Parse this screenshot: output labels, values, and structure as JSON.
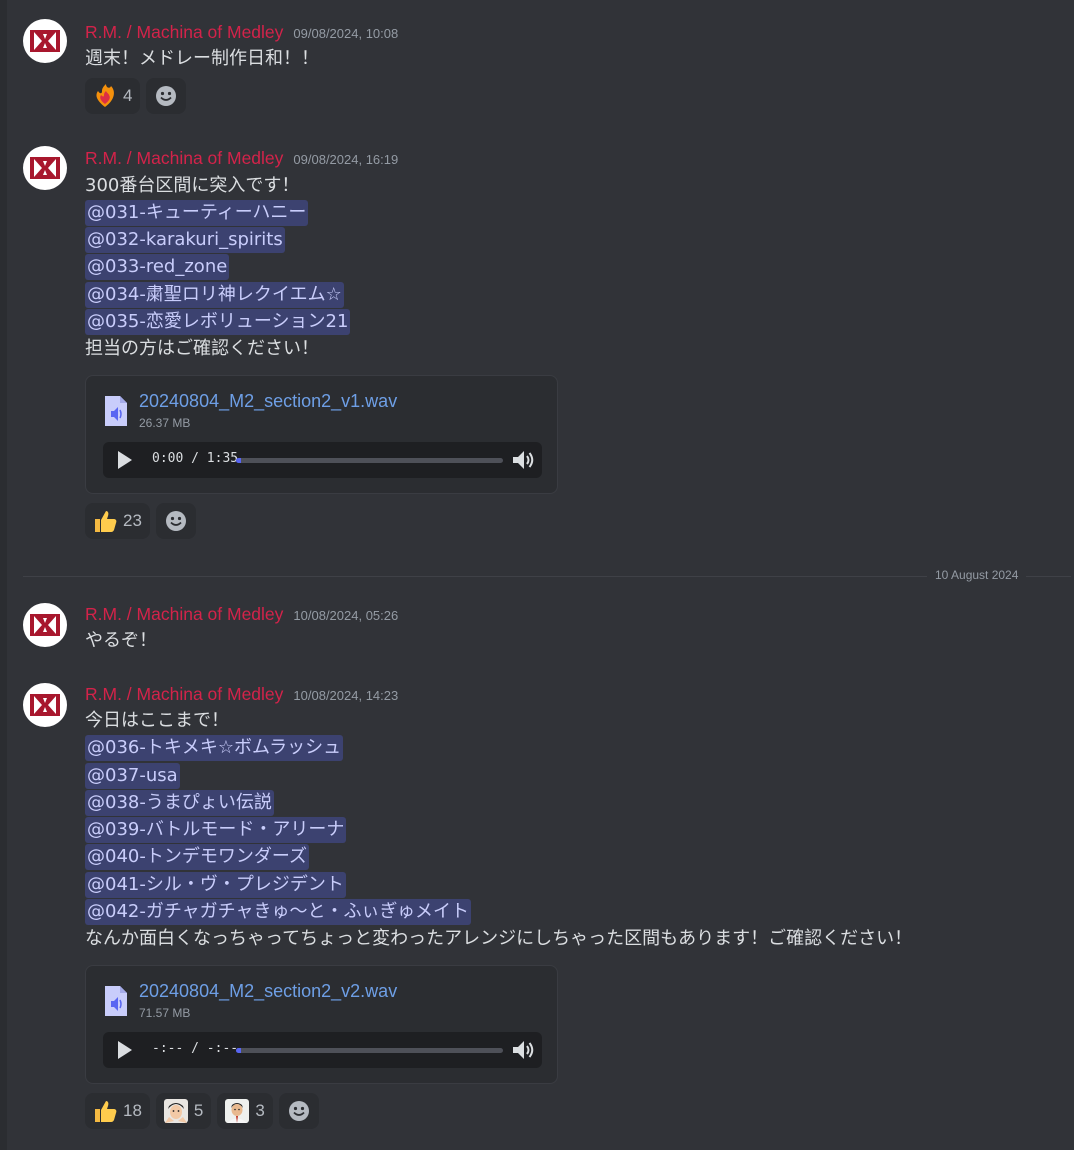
{
  "channel": {
    "date_divider": "10 August 2024",
    "messages": [
      {
        "author": "R.M. / Machina of Medley",
        "timestamp": "09/08/2024, 10:08",
        "lines": [
          "週末！メドレー制作日和！！"
        ],
        "reactions": [
          {
            "emoji": "fire-heart",
            "count": "4"
          }
        ]
      },
      {
        "author": "R.M. / Machina of Medley",
        "timestamp": "09/08/2024, 16:19",
        "lines": [
          "300番台区間に突入です！",
          "@031-キューティーハニー",
          "@032-karakuri_spirits",
          "@033-red_zone",
          "@034-粛聖ロリ神レクイエム☆",
          "@035-恋愛レボリューション21",
          "担当の方はご確認ください！"
        ],
        "attachment": {
          "filename": "20240804_M2_section2_v1.wav",
          "size": "26.37 MB",
          "time": "0:00 / 1:35",
          "progress": 0.02
        },
        "reactions": [
          {
            "emoji": "thumbs-up",
            "count": "23"
          }
        ]
      },
      {
        "author": "R.M. / Machina of Medley",
        "timestamp": "10/08/2024, 05:26",
        "lines": [
          "やるぞ！"
        ]
      },
      {
        "author": "R.M. / Machina of Medley",
        "timestamp": "10/08/2024, 14:23",
        "lines": [
          "今日はここまで！",
          "@036-トキメキ☆ボムラッシュ",
          "@037-usa",
          "@038-うまぴょい伝説",
          "@039-バトルモード・アリーナ",
          "@040-トンデモワンダーズ",
          "@041-シル・ヴ・プレジデント",
          "@042-ガチャガチャきゅ～と・ふぃぎゅメイト",
          "なんか面白くなっちゃってちょっと変わったアレンジにしちゃった区間もあります！ご確認ください！"
        ],
        "attachment": {
          "filename": "20240804_M2_section2_v2.wav",
          "size": "71.57 MB",
          "time": "-:-- / -:--",
          "progress": 0.02
        },
        "reactions": [
          {
            "emoji": "thumbs-up",
            "count": "18"
          },
          {
            "emoji": "custom-face-a",
            "count": "5"
          },
          {
            "emoji": "custom-face-b",
            "count": "3"
          }
        ]
      }
    ]
  }
}
